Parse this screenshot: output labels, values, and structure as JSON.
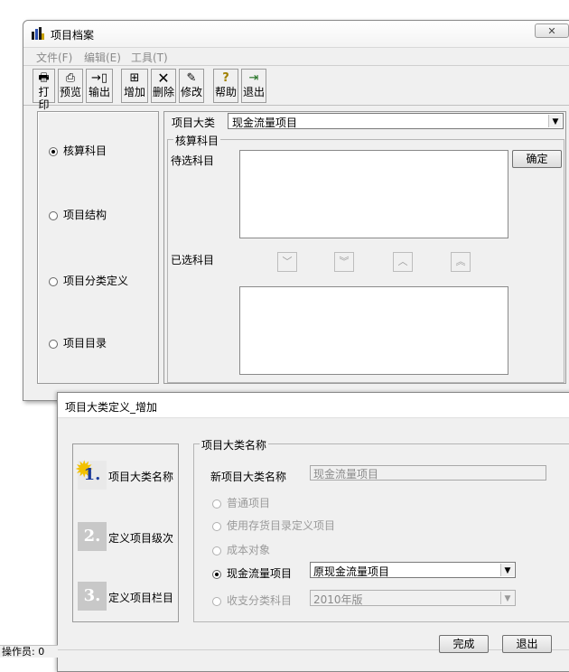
{
  "main_window": {
    "title": "项目档案",
    "menu": [
      "文件(F)",
      "编辑(E)",
      "工具(T)"
    ],
    "toolbar": [
      {
        "label": "打印",
        "icon": "printer-icon",
        "glyph": "🖶"
      },
      {
        "label": "预览",
        "icon": "preview-icon",
        "glyph": "🔍"
      },
      {
        "label": "输出",
        "icon": "export-icon",
        "glyph": "➔"
      },
      {
        "label": "增加",
        "icon": "add-icon",
        "glyph": "+"
      },
      {
        "label": "删除",
        "icon": "delete-icon",
        "glyph": "✕"
      },
      {
        "label": "修改",
        "icon": "edit-icon",
        "glyph": "✎"
      },
      {
        "label": "帮助",
        "icon": "help-icon",
        "glyph": "?"
      },
      {
        "label": "退出",
        "icon": "exit-icon",
        "glyph": "⇥"
      }
    ],
    "left_options": [
      {
        "label": "核算科目",
        "selected": true
      },
      {
        "label": "项目结构",
        "selected": false
      },
      {
        "label": "项目分类定义",
        "selected": false
      },
      {
        "label": "项目目录",
        "selected": false
      }
    ],
    "category_label": "项目大类",
    "category_value": "现金流量项目",
    "group_title": "核算科目",
    "pending_label": "待选科目",
    "selected_label": "已选科目",
    "confirm_button": "确定",
    "arrow_buttons": [
      "﹀",
      "︾",
      "︿",
      "︽"
    ]
  },
  "dialog": {
    "title": "项目大类定义_增加",
    "steps": [
      {
        "num": "1.",
        "label": "项目大类名称",
        "active": true
      },
      {
        "num": "2.",
        "label": "定义项目级次",
        "active": false
      },
      {
        "num": "3.",
        "label": "定义项目栏目",
        "active": false
      }
    ],
    "group_title": "项目大类名称",
    "new_name_label": "新项目大类名称",
    "new_name_value": "现金流量项目",
    "options": [
      {
        "label": "普通项目",
        "selected": false,
        "enabled": false
      },
      {
        "label": "使用存货目录定义项目",
        "selected": false,
        "enabled": false
      },
      {
        "label": "成本对象",
        "selected": false,
        "enabled": false
      },
      {
        "label": "现金流量项目",
        "selected": true,
        "enabled": true
      },
      {
        "label": "收支分类科目",
        "selected": false,
        "enabled": false
      }
    ],
    "cashflow_select": "原现金流量项目",
    "income_select": "2010年版",
    "finish_button": "完成",
    "exit_button": "退出"
  },
  "status_bar": {
    "text": "操作员: 0"
  }
}
